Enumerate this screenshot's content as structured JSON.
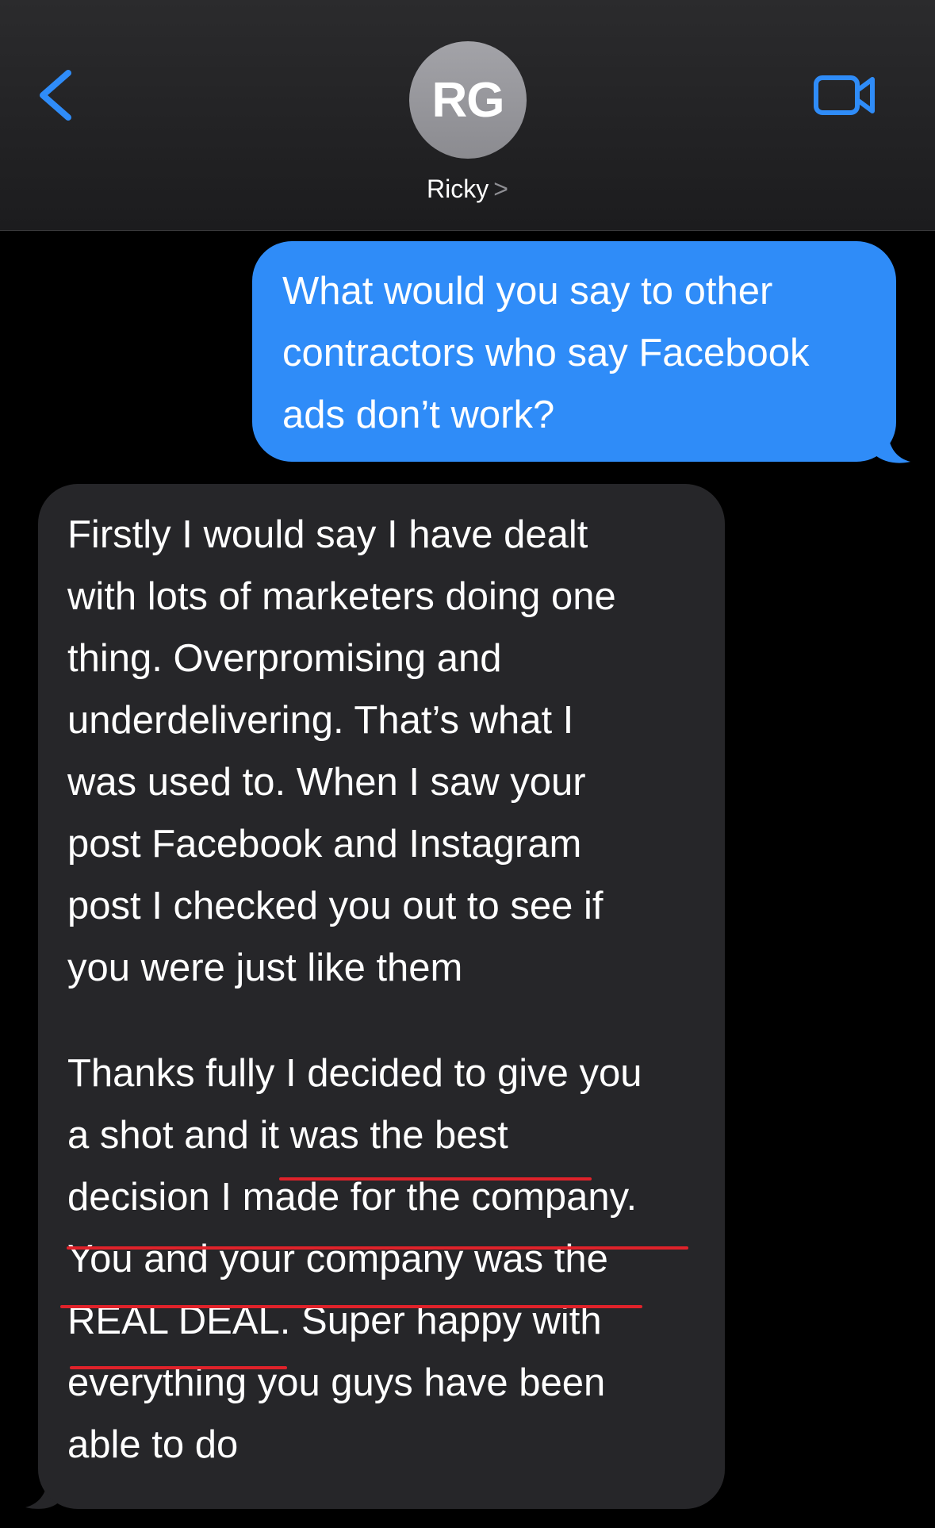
{
  "header": {
    "back_icon": "chevron-left-icon",
    "avatar_initials": "RG",
    "contact_name": "Ricky",
    "contact_chevron": ">",
    "video_icon": "video-camera-icon",
    "accent_color": "#2f8cf8"
  },
  "messages": [
    {
      "direction": "sent",
      "lines": [
        "What would you say to other",
        "contractors who say Facebook",
        "ads don’t work?"
      ]
    },
    {
      "direction": "received",
      "lines": [
        "Firstly I would say I have dealt",
        "with lots of marketers doing one",
        "thing. Overpromising and",
        "underdelivering. That’s what I",
        "was used to. When I saw your",
        "post Facebook and Instagram",
        "post I checked you out to see if",
        "you were just like them",
        "",
        "Thanks fully I decided to give you",
        "a shot and it was the best",
        "decision I made for the company.",
        "You and your company was the",
        "REAL DEAL. Super happy with",
        "everything you guys have been",
        "able to do"
      ],
      "highlight_color": "#e0222a"
    }
  ]
}
